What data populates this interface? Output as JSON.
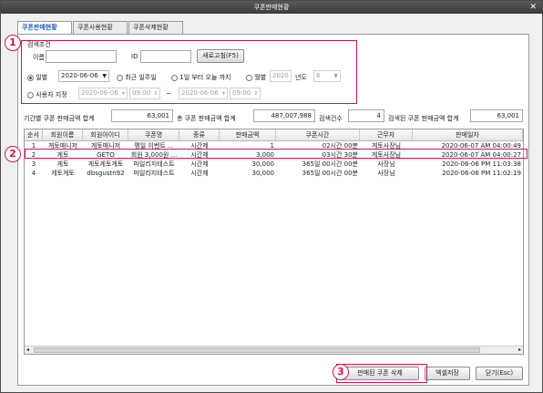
{
  "window": {
    "title": "쿠폰판매현황",
    "close": "✕"
  },
  "tabs": [
    "쿠폰판매현황",
    "쿠폰사용현황",
    "쿠폰삭제현황"
  ],
  "search": {
    "group_label": "검색조건",
    "name_label": "이름",
    "id_label": "ID",
    "refresh_label": "새로고침(F5)",
    "daily_label": "일별",
    "daily_date": "2020-06-06",
    "week_label": "최근 일주일",
    "month_start_label": "1일 부터 오늘 까지",
    "monthly_label": "월별",
    "year_value": "2020",
    "year_label": "년도",
    "month_value": "6",
    "custom_label": "사용자 지정",
    "from_date": "2020-06-06",
    "from_time": "09:00",
    "tilde": "~",
    "to_date": "2020-06-06",
    "to_time": "09:00"
  },
  "summary": {
    "period_total_label": "기간별 쿠폰 판매금액 합계",
    "period_total": "63,001",
    "all_total_label": "총 쿠폰 판매금액 합계",
    "all_total": "487,007,988",
    "count_label": "검색건수",
    "count": "4",
    "found_total_label": "검색된 쿠폰 판매금액 합계",
    "found_total": "63,001"
  },
  "table": {
    "headers": [
      "순서",
      "회원이름",
      "회원아이디",
      "쿠폰명",
      "종류",
      "판매금액",
      "쿠폰시간",
      "근무자",
      "판매일자"
    ],
    "rows": [
      [
        "1",
        "게토매니저",
        "게토매니저",
        "평일 이벤트 ...",
        "시간제",
        "1",
        "02시간 00분",
        "게토사장님",
        "2020-06-07 AM 04:00:49"
      ],
      [
        "2",
        "게토",
        "GETO",
        "회원 3,000원 ...",
        "시간제",
        "3,000",
        "03시간 30분",
        "게토사장님",
        "2020-06-07 AM 04:00:27"
      ],
      [
        "3",
        "게토",
        "게토게토게토",
        "마일리지테스트",
        "시간제",
        "30,000",
        "365일 00시간 00분",
        "사장님",
        "2020-06-06 PM 11:03:38"
      ],
      [
        "4",
        "게토게토",
        "dbsgustn92",
        "마일리지테스트",
        "시간제",
        "30,000",
        "365일 00시간 00분",
        "사장님",
        "2020-06-06 PM 11:02:19"
      ]
    ]
  },
  "footer": {
    "delete_label": "판매된 쿠폰 삭제",
    "excel_label": "엑셀저장",
    "close_label": "닫기(Esc)"
  },
  "annotations": [
    "1",
    "2",
    "3"
  ],
  "colors": {
    "highlight": "#c9184a",
    "accent": "#1b5fb5"
  }
}
